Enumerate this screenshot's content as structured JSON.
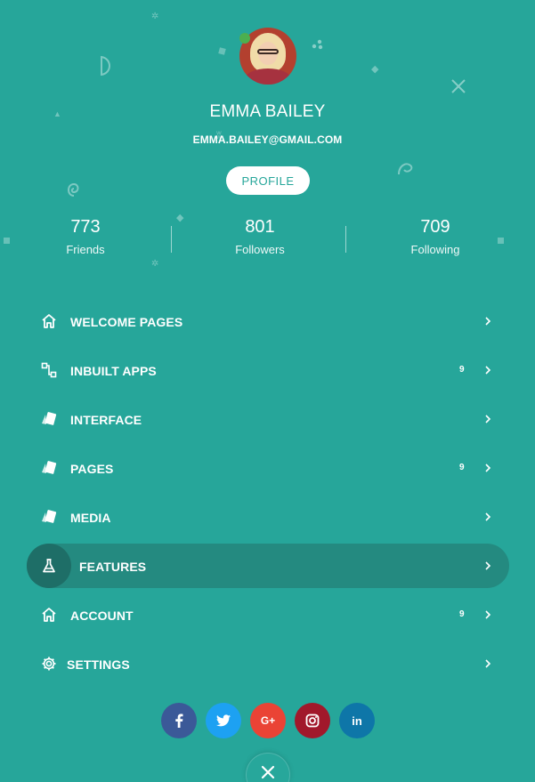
{
  "user": {
    "name": "EMMA BAILEY",
    "email": "EMMA.BAILEY@GMAIL.COM",
    "profile_button": "PROFILE",
    "status": "online",
    "status_color": "#4caf50"
  },
  "stats": [
    {
      "value": "773",
      "label": "Friends"
    },
    {
      "value": "801",
      "label": "Followers"
    },
    {
      "value": "709",
      "label": "Following"
    }
  ],
  "menu": [
    {
      "label": "WELCOME PAGES",
      "icon": "home-icon",
      "badge": ""
    },
    {
      "label": "INBUILT APPS",
      "icon": "apps-icon",
      "badge": "9"
    },
    {
      "label": "INTERFACE",
      "icon": "cards-icon",
      "badge": ""
    },
    {
      "label": "PAGES",
      "icon": "cards-icon",
      "badge": "9"
    },
    {
      "label": "MEDIA",
      "icon": "cards-icon",
      "badge": ""
    },
    {
      "label": "FEATURES",
      "icon": "flask-icon",
      "badge": "",
      "active": true
    },
    {
      "label": "ACCOUNT",
      "icon": "home-icon",
      "badge": "9"
    },
    {
      "label": "SETTINGS",
      "icon": "gear-icon",
      "badge": ""
    }
  ],
  "social": [
    {
      "name": "facebook",
      "glyph": "f",
      "color": "#3b5998"
    },
    {
      "name": "twitter",
      "glyph": "t",
      "color": "#1da1f2"
    },
    {
      "name": "google-plus",
      "glyph": "G+",
      "color": "#ea4335"
    },
    {
      "name": "instagram",
      "glyph": "ig",
      "color": "#a1182b"
    },
    {
      "name": "linkedin",
      "glyph": "in",
      "color": "#0e76a8"
    }
  ],
  "colors": {
    "background": "#26a69a",
    "active_pill": "#248a80",
    "active_icon_bg": "#1e6e67"
  }
}
